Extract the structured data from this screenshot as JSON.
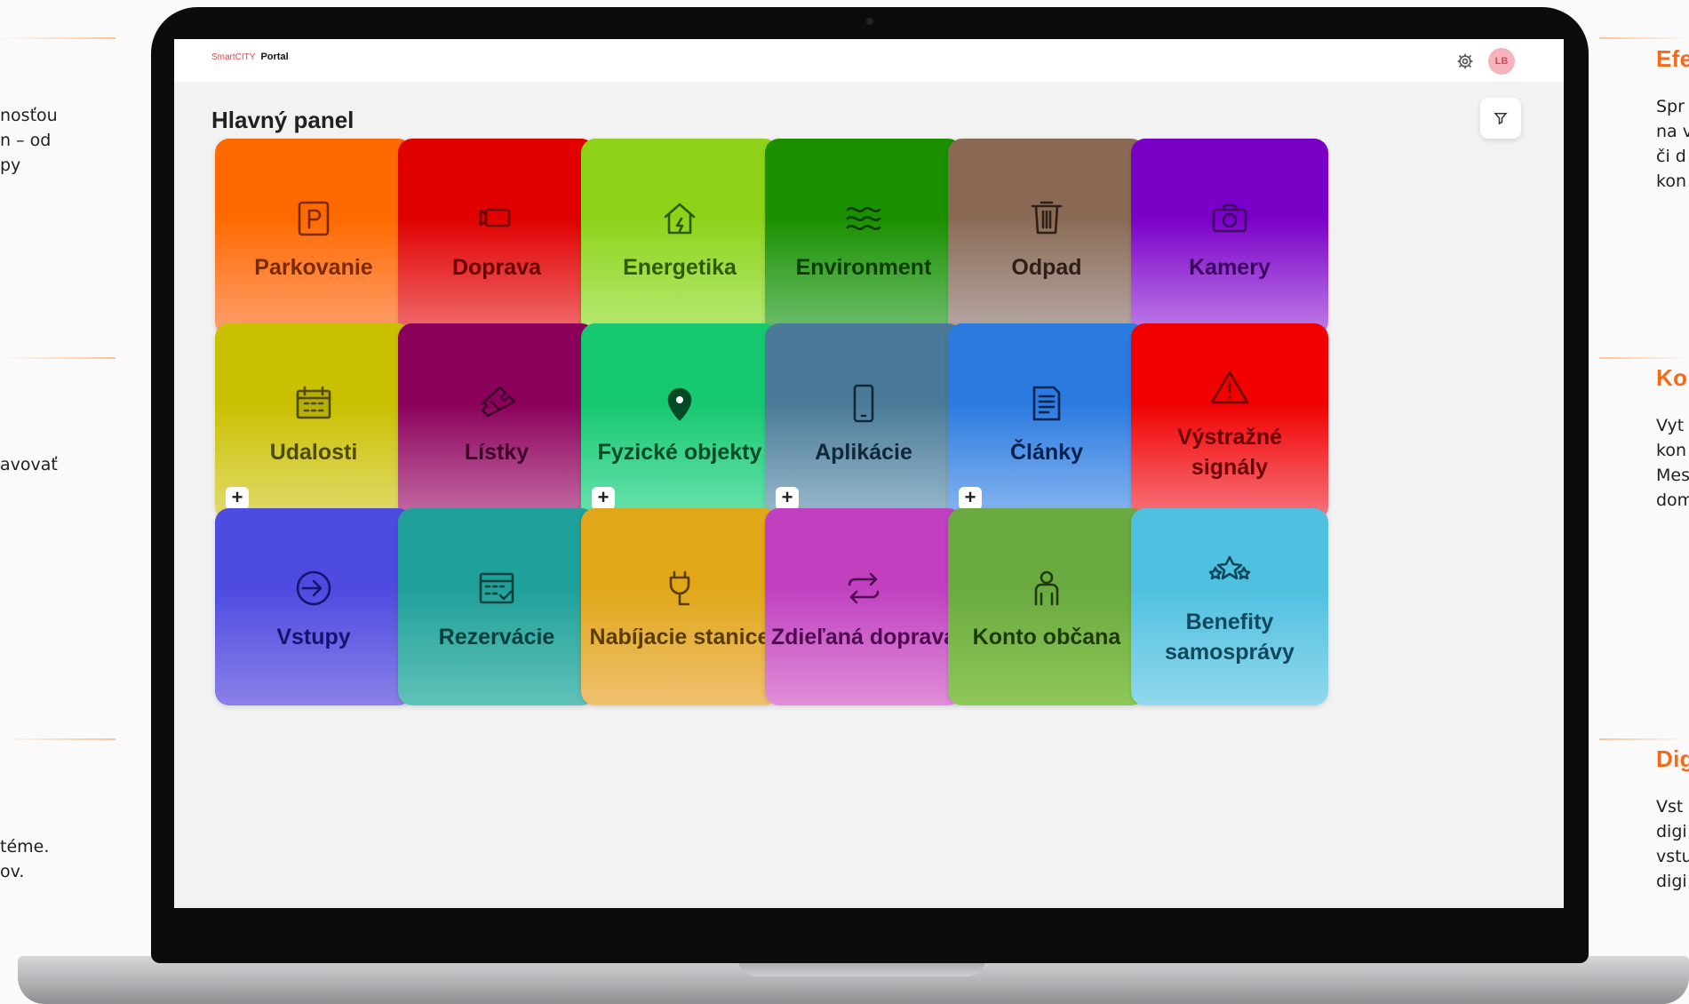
{
  "page": {
    "left_snippets": [
      [
        "nosťou",
        "n – od",
        "py"
      ],
      [
        "avovať"
      ],
      [
        "téme.",
        "",
        "ov."
      ]
    ],
    "right_sections": [
      {
        "heading": "Efe",
        "lines": [
          "Spr",
          "na v",
          "či d",
          "kon"
        ]
      },
      {
        "heading": "Ko",
        "lines": [
          "Vyt",
          "kon",
          "Mes",
          "dom"
        ]
      },
      {
        "heading": "Dig",
        "lines": [
          "Vst",
          "digi",
          "vstu",
          "digi"
        ]
      }
    ]
  },
  "app": {
    "logo_prefix": "Smart",
    "logo_city": "CITY",
    "logo_suffix": "Portal",
    "avatar_initials": "LB",
    "title": "Hlavný panel",
    "colors": {
      "accent": "#f26a1a"
    }
  },
  "tiles": [
    {
      "label": "Parkovanie",
      "icon": "parking-icon",
      "top": "#ff6a00",
      "bottom": "#ffa070"
    },
    {
      "label": "Doprava",
      "icon": "video-camera-icon",
      "top": "#e00000",
      "bottom": "#f07070"
    },
    {
      "label": "Energetika",
      "icon": "home-energy-icon",
      "top": "#8ed31a",
      "bottom": "#b8ea78"
    },
    {
      "label": "Environment",
      "icon": "waves-icon",
      "top": "#1a9000",
      "bottom": "#72c072"
    },
    {
      "label": "Odpad",
      "icon": "trash-icon",
      "top": "#8a6a55",
      "bottom": "#b8aaa8"
    },
    {
      "label": "Kamery",
      "icon": "camera-icon",
      "top": "#7a00c8",
      "bottom": "#c080e8"
    },
    {
      "label": "Udalosti",
      "icon": "calendar-icon",
      "top": "#c8c000",
      "bottom": "#e3db70",
      "plus": "+"
    },
    {
      "label": "Lístky",
      "icon": "ticket-icon",
      "top": "#8a005a",
      "bottom": "#c670a8"
    },
    {
      "label": "Fyzické objekty",
      "icon": "location-pin-icon",
      "top": "#16c870",
      "bottom": "#6de3b0",
      "plus": "+"
    },
    {
      "label": "Aplikácie",
      "icon": "smartphone-icon",
      "top": "#4a7a98",
      "bottom": "#9cbcce",
      "plus": "+"
    },
    {
      "label": "Články",
      "icon": "document-icon",
      "top": "#2a7ae0",
      "bottom": "#8ab8f0",
      "plus": "+"
    },
    {
      "label": "Výstražné signály",
      "icon": "warning-icon",
      "top": "#f00000",
      "bottom": "#f87880"
    },
    {
      "label": "Vstupy",
      "icon": "login-arrow-icon",
      "top": "#4d4be0",
      "bottom": "#8a80e8"
    },
    {
      "label": "Rezervácie",
      "icon": "calendar-check-icon",
      "top": "#20a09a",
      "bottom": "#60c2b8"
    },
    {
      "label": "Nabíjacie stanice",
      "icon": "charging-plug-icon",
      "top": "#e0a818",
      "bottom": "#f0c070"
    },
    {
      "label": "Zdieľaná doprava",
      "icon": "repeat-arrows-icon",
      "top": "#c040c0",
      "bottom": "#e08ed8"
    },
    {
      "label": "Konto občana",
      "icon": "person-icon",
      "top": "#6aaa40",
      "bottom": "#8ec858"
    },
    {
      "label": "Benefity samosprávy",
      "icon": "stars-icon",
      "top": "#50c0e0",
      "bottom": "#90d8ec"
    }
  ]
}
